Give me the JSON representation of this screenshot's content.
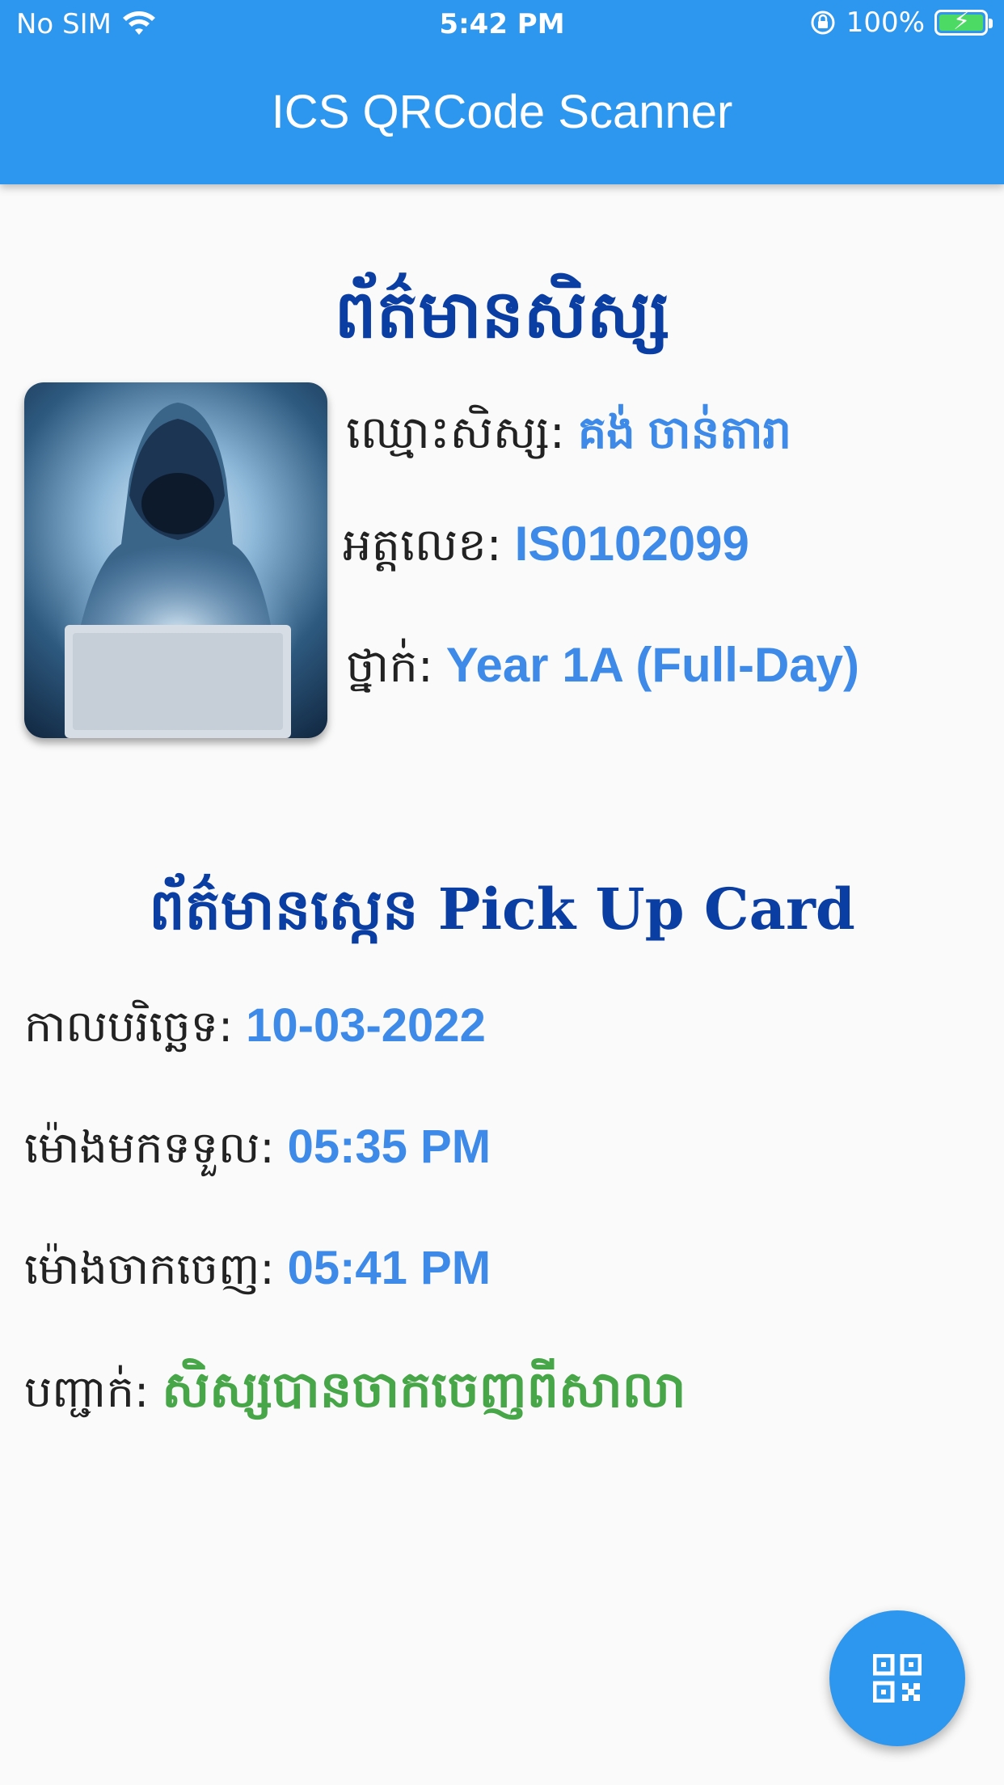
{
  "status_bar": {
    "carrier": "No SIM",
    "time": "5:42 PM",
    "battery": "100%",
    "icons": [
      "wifi-icon",
      "orientation-lock-icon",
      "battery-charging-icon"
    ]
  },
  "app_bar": {
    "title": "ICS QRCode Scanner"
  },
  "student_section": {
    "title": "ព័ត៌មានសិស្ស",
    "name_label": "ឈ្មោះសិស្ស:",
    "name_value": "គង់ ចាន់តារា",
    "id_label": "អត្តលេខ:",
    "id_value": "IS0102099",
    "grade_label": "ថ្នាក់:",
    "grade_value": "Year 1A (Full-Day)"
  },
  "pickup_section": {
    "title": "ព័ត៌មានស្កេន Pick Up Card",
    "date_label": "កាលបរិច្ឆេទ:",
    "date_value": "10-03-2022",
    "arrival_label": "ម៉ោងមកទទួល:",
    "arrival_value": "05:35 PM",
    "departure_label": "ម៉ោងចាកចេញ:",
    "departure_value": "05:41 PM",
    "confirm_label": "បញ្ជាក់:",
    "confirm_value": "សិស្សបានចាកចេញពីសាលា"
  },
  "fab": {
    "icon": "qr-code-icon"
  },
  "colors": {
    "primary": "#2d96ee",
    "title": "#0b3ea3",
    "value": "#3e8ae8",
    "success": "#47a648"
  }
}
